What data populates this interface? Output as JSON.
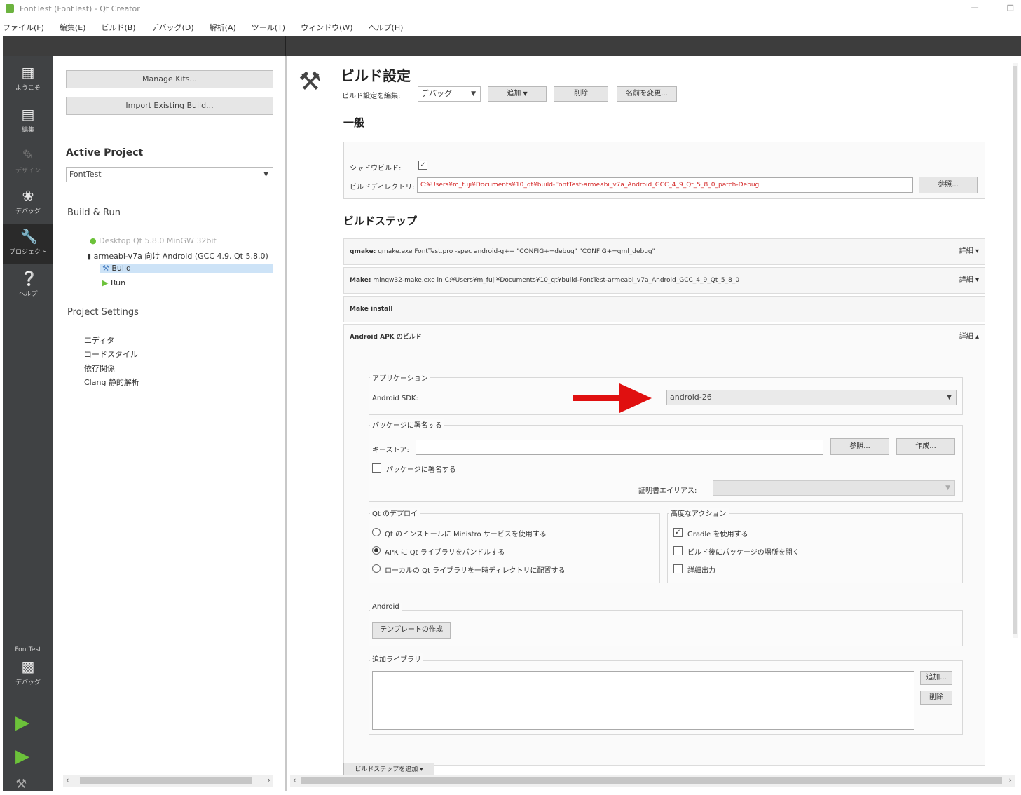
{
  "window": {
    "title": "FontTest (FontTest) - Qt Creator",
    "controls": [
      "—",
      "□"
    ]
  },
  "menu": [
    "ファイル(F)",
    "編集(E)",
    "ビルド(B)",
    "デバッグ(D)",
    "解析(A)",
    "ツール(T)",
    "ウィンドウ(W)",
    "ヘルプ(H)"
  ],
  "modes": {
    "welcome": "ようこそ",
    "edit": "編集",
    "design": "デザイン",
    "debug": "デバッグ",
    "projects": "プロジェクト",
    "help": "ヘルプ",
    "kit_project": "FontTest",
    "kit_mode": "デバッグ"
  },
  "left": {
    "manage_kits": "Manage Kits...",
    "import_build": "Import Existing Build...",
    "active_project_label": "Active Project",
    "active_project_value": "FontTest",
    "build_run_label": "Build & Run",
    "kits": [
      {
        "label": "Desktop Qt 5.8.0 MinGW 32bit"
      },
      {
        "label": "armeabi-v7a 向け Android (GCC 4.9, Qt 5.8.0)"
      }
    ],
    "build": "Build",
    "run": "Run",
    "project_settings_label": "Project Settings",
    "settings": [
      "エディタ",
      "コードスタイル",
      "依存関係",
      "Clang 静的解析"
    ]
  },
  "main": {
    "title": "ビルド設定",
    "edit_label": "ビルド設定を編集:",
    "config_value": "デバッグ",
    "add_label": "追加",
    "delete_label": "削除",
    "rename_label": "名前を変更...",
    "general_section": "一般",
    "shadow_build_label": "シャドウビルド:",
    "build_dir_label": "ビルドディレクトリ:",
    "build_dir_value": "C:¥Users¥m_fuji¥Documents¥10_qt¥build-FontTest-armeabi_v7a_Android_GCC_4_9_Qt_5_8_0_patch-Debug",
    "browse_label": "参照...",
    "build_steps_section": "ビルドステップ",
    "steps": [
      {
        "title": "qmake:",
        "detail": "qmake.exe FontTest.pro -spec android-g++ \"CONFIG+=debug\" \"CONFIG+=qml_debug\"",
        "toggle": "詳細 ▾"
      },
      {
        "title": "Make:",
        "detail": "mingw32-make.exe in C:¥Users¥m_fuji¥Documents¥10_qt¥build-FontTest-armeabi_v7a_Android_GCC_4_9_Qt_5_8_0",
        "toggle": "詳細 ▾"
      },
      {
        "title": "Make install",
        "detail": "",
        "toggle": ""
      },
      {
        "title": "Android APK のビルド",
        "detail": "",
        "toggle": "詳細 ▴"
      }
    ],
    "app_group": "アプリケーション",
    "sdk_label": "Android SDK:",
    "sdk_value": "android-26",
    "sign_group": "パッケージに署名する",
    "keystore_label": "キーストア:",
    "keystore_browse": "参照...",
    "keystore_create": "作成...",
    "sign_checkbox": "パッケージに署名する",
    "cert_alias_label": "証明書エイリアス:",
    "deploy_group": "Qt のデプロイ",
    "deploy_options": [
      {
        "label": "Qt のインストールに Ministro サービスを使用する",
        "checked": false
      },
      {
        "label": "APK に Qt ライブラリをバンドルする",
        "checked": true
      },
      {
        "label": "ローカルの Qt ライブラリを一時ディレクトリに配置する",
        "checked": false
      }
    ],
    "advanced_group": "高度なアクション",
    "advanced_options": [
      {
        "label": "Gradle を使用する",
        "checked": true
      },
      {
        "label": "ビルド後にパッケージの場所を開く",
        "checked": false
      },
      {
        "label": "詳細出力",
        "checked": false
      }
    ],
    "android_group": "Android",
    "template_button": "テンプレートの作成",
    "libs_group": "追加ライブラリ",
    "libs_add": "追加...",
    "libs_remove": "削除",
    "add_step_button": "ビルドステップを追加 ▾"
  },
  "colors": {
    "modebar": "#404244",
    "accent_green": "#8bd24a",
    "error_red": "#d42a2a",
    "arrow_red": "#e01010"
  }
}
